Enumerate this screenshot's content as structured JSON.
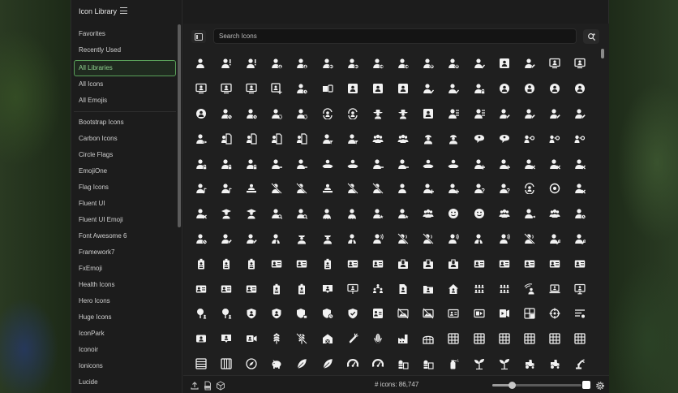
{
  "app": {
    "title": "Icon Library"
  },
  "sidebar": {
    "top_items": [
      {
        "label": "Favorites",
        "active": false
      },
      {
        "label": "Recently Used",
        "active": false
      }
    ],
    "library_items": [
      {
        "label": "All Libraries",
        "active": true
      },
      {
        "label": "All Icons",
        "active": false
      },
      {
        "label": "All Emojis",
        "active": false
      }
    ],
    "sets": [
      "Bootstrap Icons",
      "Carbon Icons",
      "Circle Flags",
      "EmojiOne",
      "Flag Icons",
      "Fluent UI",
      "Fluent UI Emoji",
      "Font Awesome 6",
      "Framework7",
      "FxEmoji",
      "Health Icons",
      "Hero Icons",
      "Huge Icons",
      "IconPark",
      "Iconoir",
      "Ionicons",
      "Lucide"
    ]
  },
  "search": {
    "placeholder": "Search Icons",
    "value": ""
  },
  "footer": {
    "count_label": "# icons: 86,747",
    "zoom": 0.22,
    "swatch_color": "#ffffff"
  },
  "icon_rows": [
    [
      "person",
      "person-alert",
      "person-alert",
      "person-down",
      "person-down",
      "person-left",
      "person-left",
      "person-right",
      "person-right",
      "person-up",
      "person-up",
      "person-check",
      "person-card",
      "person-edit",
      "person-board",
      "person-board"
    ],
    [
      "person-board",
      "person-board",
      "person-board",
      "person-add-board",
      "person-clock",
      "person-rect",
      "person-card",
      "person-card",
      "person-card",
      "person-check",
      "person-check",
      "person-lock",
      "person-circle",
      "person-badge",
      "person-circle",
      "person-circle"
    ],
    [
      "person-circle",
      "person-clock",
      "person-clock",
      "person-gear",
      "person-gear",
      "person-sync",
      "person-sync",
      "person-cowboy",
      "person-cowboy",
      "person-card",
      "person-list",
      "person-list",
      "person-edit",
      "person-edit",
      "person-edit",
      "person-edit"
    ],
    [
      "person-eye",
      "person-doc",
      "person-doc",
      "person-doc",
      "person-doc",
      "person-filter",
      "person-filter",
      "person-group",
      "person-group",
      "person-worker",
      "person-worker",
      "person-chat",
      "person-chat",
      "person-key",
      "person-key",
      "person-key"
    ],
    [
      "person-lock",
      "person-lock",
      "person-lock",
      "person-minus",
      "person-minus",
      "person-hands",
      "person-hands",
      "person-minus",
      "person-minus",
      "person-hands",
      "person-hands",
      "person-add",
      "person-add",
      "person-x",
      "person-x",
      "person-x"
    ],
    [
      "person-note",
      "person-note",
      "person-laptop",
      "person-slash",
      "person-slash",
      "person-laptop",
      "person-slash",
      "person-slash",
      "person-single",
      "person-add",
      "person-add",
      "person-question",
      "person-question",
      "person-sync",
      "person-at",
      "person-x"
    ],
    [
      "person-x",
      "person-grad",
      "person-grad",
      "person-search",
      "person-search",
      "person-sparkle",
      "person-sparkle",
      "person-star",
      "person-star",
      "person-group",
      "person-smile",
      "person-smile",
      "person-group",
      "person-swap",
      "person-group",
      "person-clock"
    ],
    [
      "person-clock",
      "person-edit",
      "person-edit",
      "person-tie",
      "person-officer",
      "person-officer",
      "person-tie",
      "person-voice",
      "person-mute",
      "person-mute",
      "person-voice",
      "person-tie",
      "person-voice",
      "person-mute",
      "person-wrench",
      "person-wrench"
    ],
    [
      "badge",
      "badge",
      "badge",
      "id-card",
      "id-card",
      "badge",
      "id-card",
      "id-card",
      "briefcase",
      "briefcase",
      "briefcase",
      "id-card",
      "id-card",
      "id-card",
      "id-card",
      "id-card"
    ],
    [
      "id-card",
      "id-card",
      "id-card",
      "badge",
      "badge",
      "chat-person",
      "board-person",
      "people-tree",
      "doc-person",
      "folder-person",
      "home-person",
      "people-grid",
      "people-grid",
      "signal-person",
      "laptop-person",
      "monitor-person"
    ],
    [
      "tree-person",
      "tree-person",
      "shield-person",
      "shield-person",
      "shield-lock",
      "shield-clock",
      "shield-check",
      "image-card",
      "image-slash",
      "image-slash",
      "card-person",
      "video-card",
      "video-play",
      "grid-card",
      "crosshair",
      "list-card"
    ],
    [
      "card-pay",
      "chat-person",
      "video-cam",
      "wheat",
      "wheat-slash",
      "barn",
      "carrot",
      "corn",
      "factory",
      "greenhouse",
      "grid-box",
      "grid-box",
      "grid-box",
      "grid-box",
      "grid-box",
      "grid-box"
    ],
    [
      "lines-box",
      "bars-box",
      "compass",
      "piggy",
      "leaf",
      "leaf",
      "gauge",
      "gauge",
      "silo",
      "silo",
      "spray",
      "sprout",
      "sprout",
      "tractor",
      "tractor",
      "robot-arm"
    ]
  ]
}
